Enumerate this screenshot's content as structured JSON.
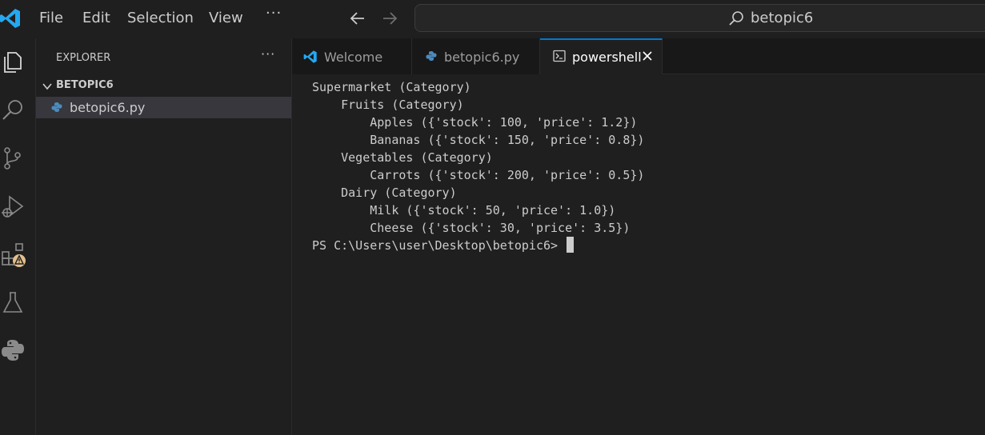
{
  "menu": {
    "file": "File",
    "edit": "Edit",
    "selection": "Selection",
    "view": "View",
    "more": "···"
  },
  "search": {
    "text": "betopic6"
  },
  "sidebar": {
    "title": "EXPLORER",
    "more": "···",
    "folder": "BETOPIC6",
    "file": "betopic6.py"
  },
  "tabs": [
    {
      "label": "Welcome",
      "icon": "vscode-logo-icon"
    },
    {
      "label": "betopic6.py",
      "icon": "python-file-icon"
    },
    {
      "label": "powershell",
      "icon": "terminal-icon",
      "active": true
    }
  ],
  "terminal": {
    "lines": [
      "Supermarket (Category)",
      "    Fruits (Category)",
      "        Apples ({'stock': 100, 'price': 1.2})",
      "        Bananas ({'stock': 150, 'price': 0.8})",
      "    Vegetables (Category)",
      "        Carrots ({'stock': 200, 'price': 0.5})",
      "    Dairy (Category)",
      "        Milk ({'stock': 50, 'price': 1.0})",
      "        Cheese ({'stock': 30, 'price': 3.5})"
    ],
    "prompt": "PS C:\\Users\\user\\Desktop\\betopic6> "
  },
  "colors": {
    "accent": "#0078d4",
    "background": "#1f1f1f",
    "warning_badge": "#e2c08d"
  }
}
